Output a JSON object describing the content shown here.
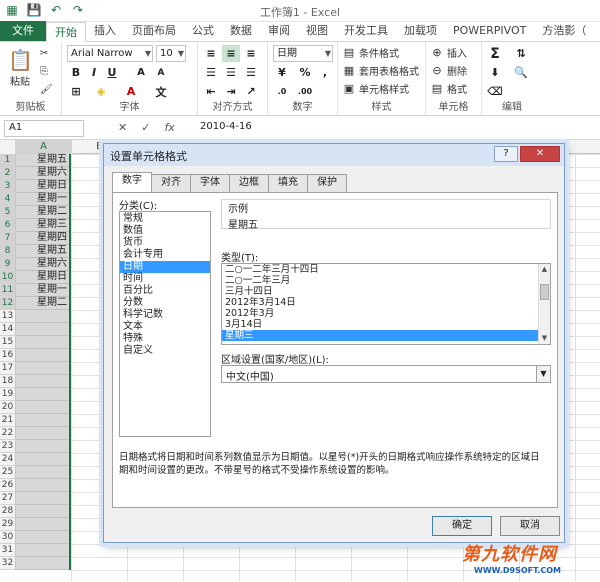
{
  "window": {
    "title": "工作簿1 - Excel"
  },
  "tabs": [
    "文件",
    "开始",
    "插入",
    "页面布局",
    "公式",
    "数据",
    "审阅",
    "视图",
    "开发工具",
    "加载项",
    "POWERPIVOT",
    "方浩影（"
  ],
  "ribbon": {
    "clipboard": {
      "paste": "粘贴",
      "label": "剪贴板"
    },
    "font": {
      "name": "Arial Narrow",
      "size": "10",
      "label": "字体"
    },
    "alignment": {
      "label": "对齐方式"
    },
    "number": {
      "format": "日期",
      "percent": "%",
      "label": "数字"
    },
    "styles": {
      "conditional": "条件格式",
      "table": "套用表格格式",
      "cell": "单元格样式",
      "label": "样式"
    },
    "cells": {
      "insert": "插入",
      "delete": "删除",
      "format": "格式",
      "label": "单元格"
    },
    "editing": {
      "label": "编辑"
    }
  },
  "formula_bar": {
    "name_box": "A1",
    "value": "2010-4-16"
  },
  "grid": {
    "columns": [
      "A",
      "B"
    ],
    "rows": [
      "1",
      "2",
      "3",
      "4",
      "5",
      "6",
      "7",
      "8",
      "9",
      "10",
      "11",
      "12",
      "13",
      "14",
      "15",
      "16",
      "17",
      "18",
      "19",
      "20",
      "21",
      "22",
      "23",
      "24",
      "25",
      "26",
      "27",
      "28",
      "29",
      "30",
      "31",
      "32"
    ],
    "colA": [
      "星期五",
      "星期六",
      "星期日",
      "星期一",
      "星期二",
      "星期三",
      "星期四",
      "星期五",
      "星期六",
      "星期日",
      "星期一",
      "星期二"
    ]
  },
  "dialog": {
    "title": "设置单元格格式",
    "help": "?",
    "close": "✕",
    "tabs": [
      "数字",
      "对齐",
      "字体",
      "边框",
      "填充",
      "保护"
    ],
    "category_label": "分类(C):",
    "categories": [
      "常规",
      "数值",
      "货币",
      "会计专用",
      "日期",
      "时间",
      "百分比",
      "分数",
      "科学记数",
      "文本",
      "特殊",
      "自定义"
    ],
    "selected_category": 4,
    "sample_label": "示例",
    "sample_value": "星期五",
    "type_label": "类型(T):",
    "types": [
      "二○一二年三月十四日",
      "二○一二年三月",
      "三月十四日",
      "2012年3月14日",
      "2012年3月",
      "3月14日",
      "星期三"
    ],
    "selected_type": 6,
    "locale_label": "区域设置(国家/地区)(L):",
    "locale_value": "中文(中国)",
    "description": "日期格式将日期和时间系列数值显示为日期值。以星号(*)开头的日期格式响应操作系统特定的区域日期和时间设置的更改。不带星号的格式不受操作系统设置的影响。",
    "ok": "确定",
    "cancel": "取消"
  },
  "watermark": {
    "line1": "第九软件网",
    "line2": "WWW.D9SOFT.COM"
  }
}
